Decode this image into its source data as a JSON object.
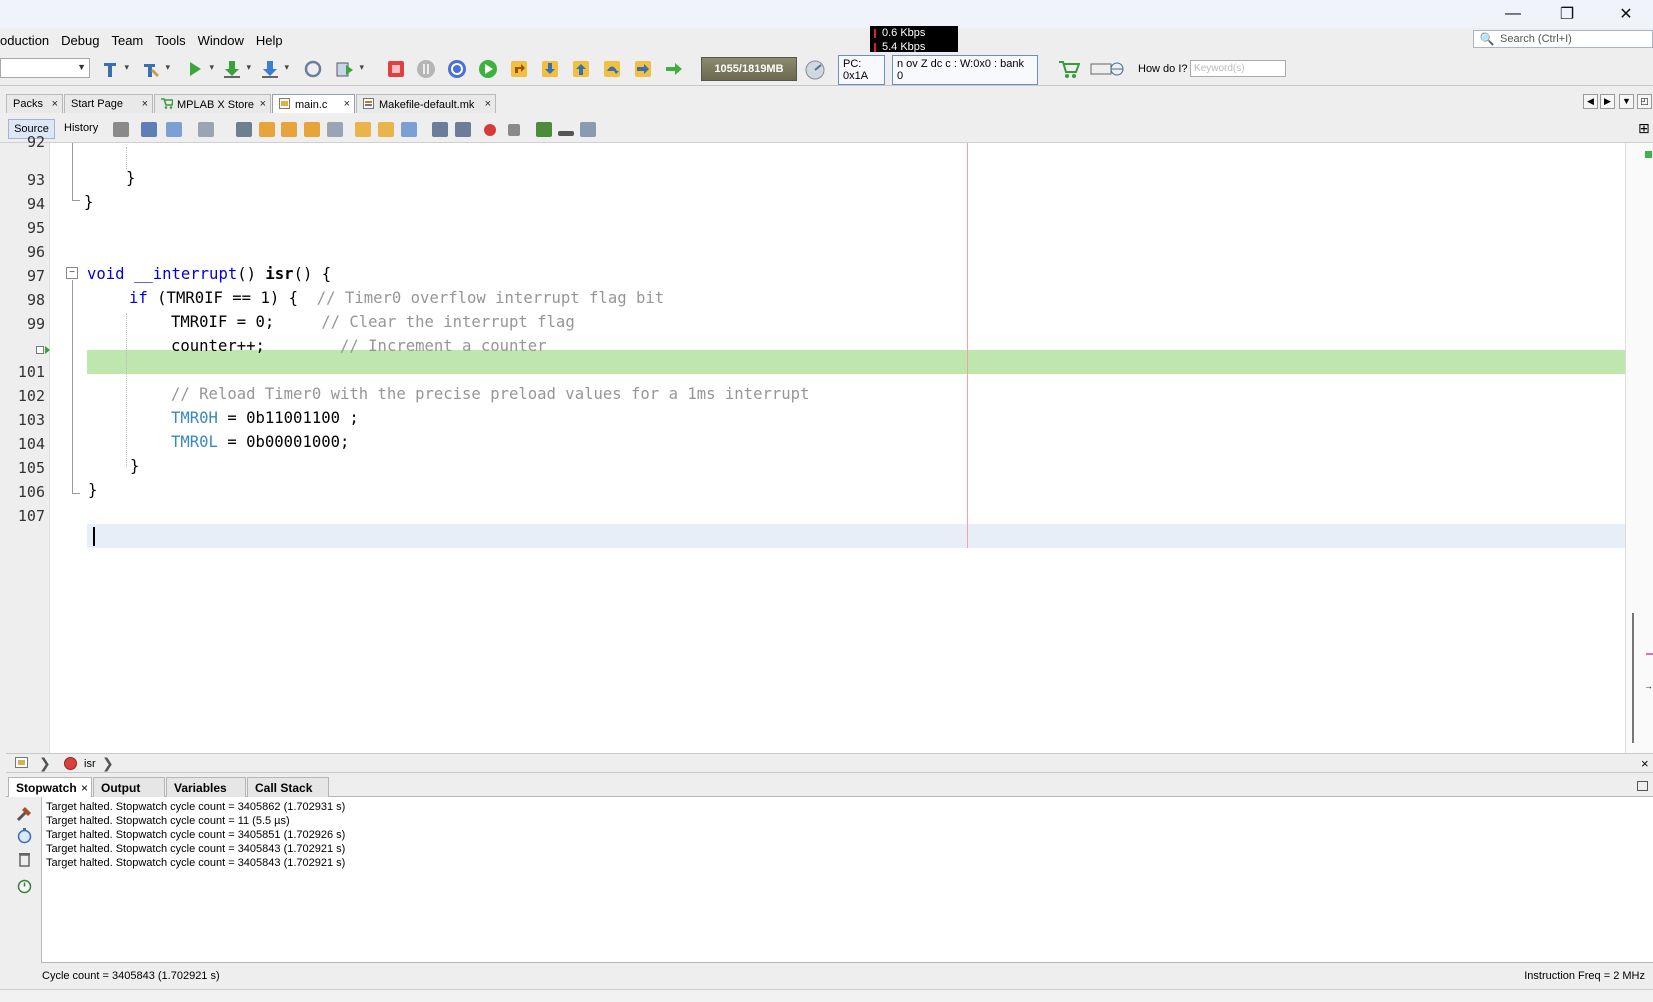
{
  "window": {
    "controls": {
      "minimize": "—",
      "maximize": "❐",
      "close": "✕"
    }
  },
  "menu": [
    "oduction",
    "Debug",
    "Team",
    "Tools",
    "Window",
    "Help"
  ],
  "search": {
    "placeholder": "Search (Ctrl+I)"
  },
  "netmon": {
    "line1": "0.6 Kbps",
    "line2": "5.4 Kbps"
  },
  "toolbar": {
    "memory": "1055/1819MB",
    "pc": "PC: 0x1A",
    "status_reg": "n ov Z dc c  : W:0x0 : bank 0",
    "howdoi": "How do I?",
    "keyword_placeholder": "Keyword(s)"
  },
  "tabs": [
    {
      "label": "Packs"
    },
    {
      "label": "Start Page"
    },
    {
      "label": "MPLAB X Store"
    },
    {
      "label": "main.c"
    },
    {
      "label": "Makefile-default.mk"
    }
  ],
  "editor_toolbar": {
    "source": "Source",
    "history": "History"
  },
  "code": {
    "line_numbers": [
      "92",
      "93",
      "94",
      "95",
      "96",
      "97",
      "98",
      "99",
      "101",
      "102",
      "103",
      "104",
      "105",
      "106",
      "107"
    ],
    "lines": {
      "l93": "}",
      "l94": "}",
      "l97_void": "void",
      "l97_interrupt": "__interrupt",
      "l97_paren": "() ",
      "l97_isr": "isr",
      "l97_rest": "() {",
      "l98_if": "if",
      "l98_cond": " (TMR0IF == 1) {  ",
      "l98_comment": "// Timer0 overflow interrupt flag bit",
      "l99_code": "TMR0IF = 0;     ",
      "l99_comment": "// Clear the interrupt flag",
      "l100_code": "counter++;        ",
      "l100_comment": "// Increment a counter",
      "l102_comment": "// Reload Timer0 with the precise preload values for a 1ms interrupt",
      "l103_sfr": "TMR0H",
      "l103_rest": " = 0b11001100 ;",
      "l104_sfr": "TMR0L",
      "l104_rest": " = 0b00001000;",
      "l105": "}",
      "l106": "}"
    }
  },
  "breadcrumb": {
    "item": "isr"
  },
  "bottom_tabs": [
    "Stopwatch",
    "Output",
    "Variables",
    "Call Stack"
  ],
  "stopwatch": {
    "lines": [
      "Target halted. Stopwatch cycle count = 3405862 (1.702931 s)",
      "Target halted. Stopwatch cycle count = 11 (5.5 µs)",
      "Target halted. Stopwatch cycle count = 3405851 (1.702926 s)",
      "Target halted. Stopwatch cycle count = 3405843 (1.702921 s)",
      "Target halted. Stopwatch cycle count = 3405843 (1.702921 s)"
    ],
    "cycle_count": "Cycle count = 3405843 (1.702921 s)",
    "instruction_freq": "Instruction Freq = 2 MHz"
  },
  "colors": {
    "exec_highlight": "#bfe6ad",
    "keyword": "#0000e6",
    "comment": "#969696",
    "sfr": "#3a88c0"
  }
}
